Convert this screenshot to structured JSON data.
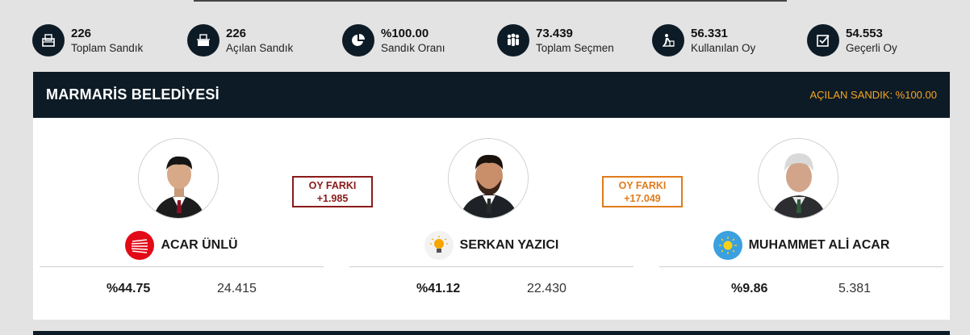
{
  "stats": [
    {
      "value": "226",
      "label": "Toplam Sandık",
      "icon": "ballot-box-icon"
    },
    {
      "value": "226",
      "label": "Açılan Sandık",
      "icon": "opened-ballot-icon"
    },
    {
      "value": "%100.00",
      "label": "Sandık Oranı",
      "icon": "pie-chart-icon"
    },
    {
      "value": "73.439",
      "label": "Toplam Seçmen",
      "icon": "voters-icon"
    },
    {
      "value": "56.331",
      "label": "Kullanılan Oy",
      "icon": "vote-cast-icon"
    },
    {
      "value": "54.553",
      "label": "Geçerli Oy",
      "icon": "check-box-icon"
    }
  ],
  "panel": {
    "title": "MARMARİS BELEDİYESİ",
    "opened": "AÇILAN SANDIK: %100.00"
  },
  "candidates": [
    {
      "name": "ACAR ÜNLÜ",
      "percent": "%44.75",
      "votes": "24.415",
      "party_icon": "chp-logo-icon",
      "color": "#e30a17"
    },
    {
      "name": "SERKAN YAZICI",
      "percent": "%41.12",
      "votes": "22.430",
      "party_icon": "akp-logo-icon",
      "color": "#f7a600"
    },
    {
      "name": "MUHAMMET ALİ ACAR",
      "percent": "%9.86",
      "votes": "5.381",
      "party_icon": "iyi-logo-icon",
      "color": "#3aa0e0"
    }
  ],
  "diffs": [
    {
      "label": "OY FARKI",
      "value": "+1.985",
      "color": "#8b1a1a"
    },
    {
      "label": "OY FARKI",
      "value": "+17.049",
      "color": "#e07b1a"
    }
  ]
}
